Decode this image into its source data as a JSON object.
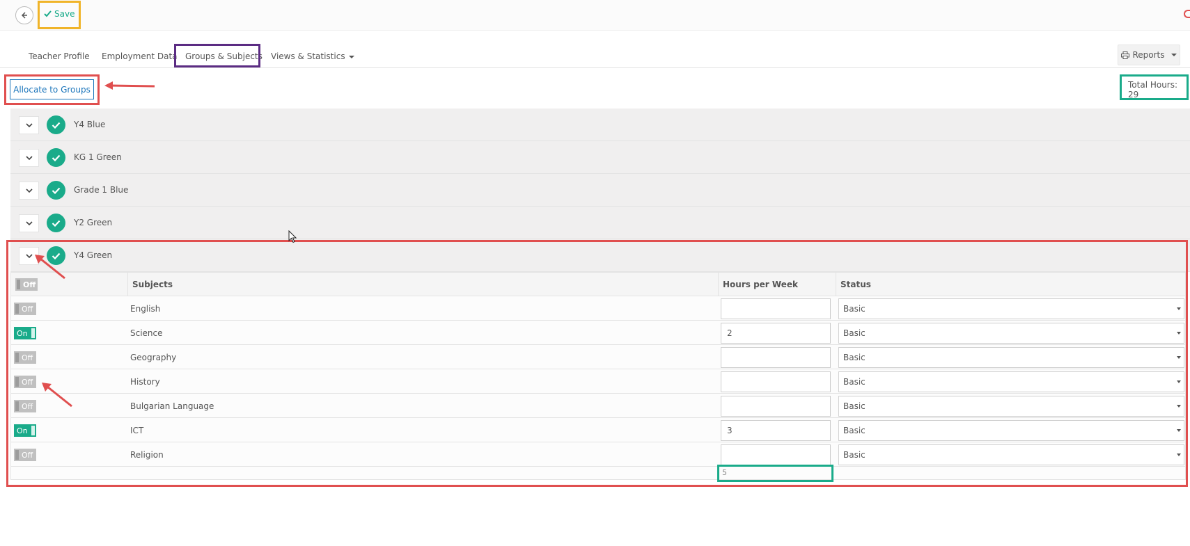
{
  "topbar": {
    "save_label": "Save"
  },
  "tabs": [
    {
      "label": "Teacher Profile"
    },
    {
      "label": "Employment Data"
    },
    {
      "label": "Groups & Subjects"
    },
    {
      "label": "Views & Statistics"
    }
  ],
  "reports": {
    "label": "Reports"
  },
  "toolbar": {
    "allocate_label": "Allocate to Groups",
    "total_hours_label": "Total Hours:",
    "total_hours_value": "29"
  },
  "groups": [
    {
      "name": "Y4 Blue"
    },
    {
      "name": "KG 1 Green"
    },
    {
      "name": "Grade 1 Blue"
    },
    {
      "name": "Y2 Green"
    },
    {
      "name": "Y4 Green"
    }
  ],
  "subjects_table": {
    "header_toggle": "Off",
    "columns": {
      "subjects": "Subjects",
      "hours": "Hours per Week",
      "status": "Status"
    },
    "rows": [
      {
        "toggle": "Off",
        "subject": "English",
        "hours": "",
        "status": "Basic"
      },
      {
        "toggle": "On",
        "subject": "Science",
        "hours": "2",
        "status": "Basic"
      },
      {
        "toggle": "Off",
        "subject": "Geography",
        "hours": "",
        "status": "Basic"
      },
      {
        "toggle": "Off",
        "subject": "History",
        "hours": "",
        "status": "Basic"
      },
      {
        "toggle": "Off",
        "subject": "Bulgarian Language",
        "hours": "",
        "status": "Basic"
      },
      {
        "toggle": "On",
        "subject": "ICT",
        "hours": "3",
        "status": "Basic"
      },
      {
        "toggle": "Off",
        "subject": "Religion",
        "hours": "",
        "status": "Basic"
      }
    ],
    "total_hours": "5"
  },
  "colors": {
    "accent_teal": "#1aab8a",
    "link_blue": "#1b75bb",
    "highlight_red": "#e04f4f",
    "highlight_orange": "#f0b429",
    "highlight_purple": "#5b2c83"
  }
}
